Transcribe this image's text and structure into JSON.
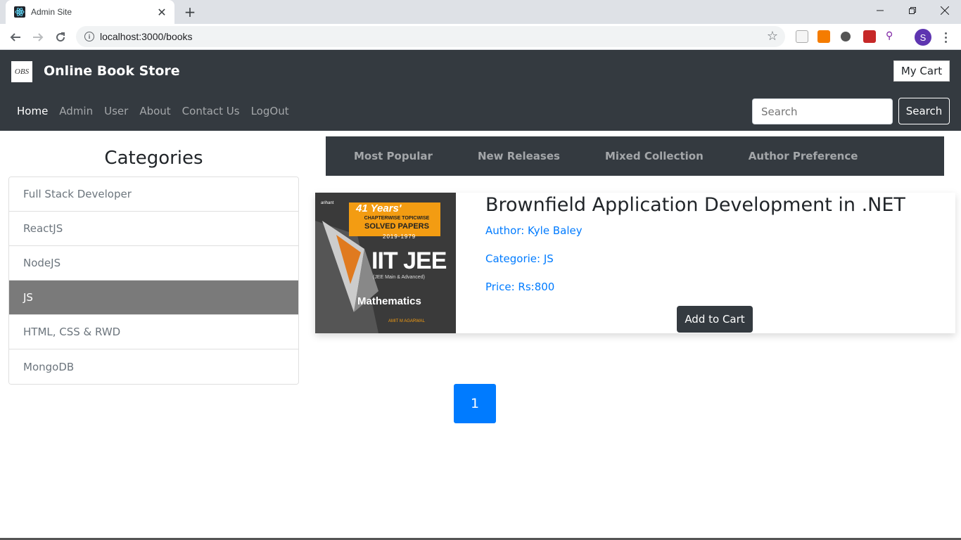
{
  "browser": {
    "tab_title": "Admin Site",
    "url": "localhost:3000/books",
    "profile_initial": "S",
    "extensions": [
      "ext-1-icon",
      "ext-2-icon",
      "ext-3-icon",
      "ext-4-icon",
      "ext-5-icon"
    ]
  },
  "navbar": {
    "logo_text": "OBS",
    "brand": "Online Book Store",
    "cart_label": "My Cart",
    "links": [
      {
        "label": "Home",
        "active": true
      },
      {
        "label": "Admin",
        "active": false
      },
      {
        "label": "User",
        "active": false
      },
      {
        "label": "About",
        "active": false
      },
      {
        "label": "Contact Us",
        "active": false
      },
      {
        "label": "LogOut",
        "active": false
      }
    ],
    "search_placeholder": "Search",
    "search_button": "Search"
  },
  "sidebar": {
    "title": "Categories",
    "items": [
      {
        "label": "Full Stack Developer",
        "active": false
      },
      {
        "label": "ReactJS",
        "active": false
      },
      {
        "label": "NodeJS",
        "active": false
      },
      {
        "label": "JS",
        "active": true
      },
      {
        "label": "HTML, CSS & RWD",
        "active": false
      },
      {
        "label": "MongoDB",
        "active": false
      }
    ]
  },
  "filters": [
    "Most Popular",
    "New Releases",
    "Mixed Collection",
    "Author Preference"
  ],
  "book": {
    "title": "Brownfield Application Development in .NET",
    "author": "Author: Kyle Baley",
    "category": "Categorie: JS",
    "price": "Price: Rs:800",
    "add_to_cart": "Add to Cart",
    "cover": {
      "publisher": "arihant",
      "years": "41 Years'",
      "subtitle1": "CHAPTERWISE TOPICWISE",
      "subtitle2": "SOLVED PAPERS",
      "range": "2019-1979",
      "exam": "IIT JEE",
      "exam_sub": "(JEE Main & Advanced)",
      "subject": "Mathematics",
      "author": "AMIT M AGARWAL"
    }
  },
  "pagination": {
    "current": "1"
  },
  "colors": {
    "nav_bg": "#343a40",
    "primary": "#007bff",
    "active_category": "#7a7a7a"
  }
}
